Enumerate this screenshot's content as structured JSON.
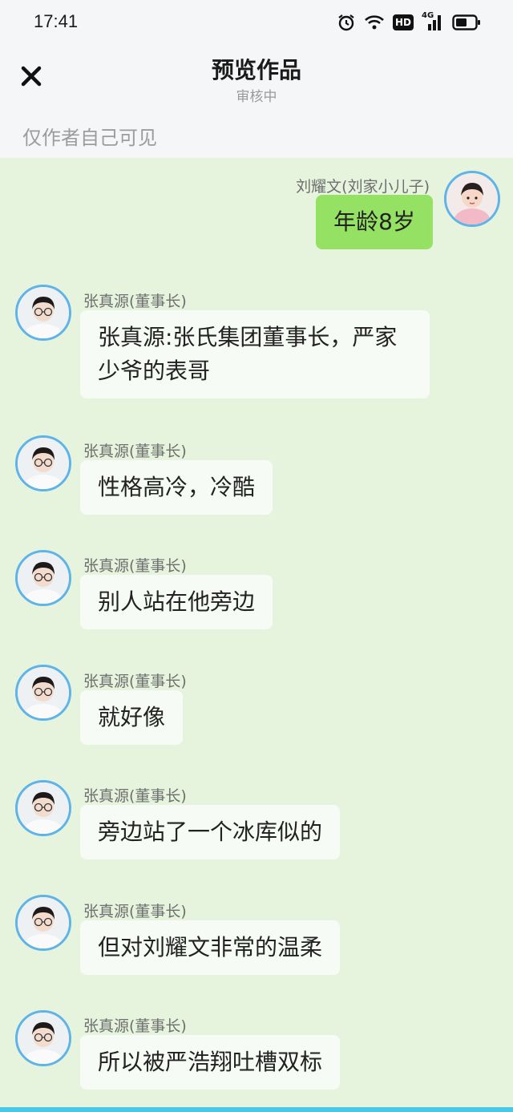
{
  "status_bar": {
    "time": "17:41",
    "icons": [
      "alarm-icon",
      "wifi-icon",
      "hd-icon",
      "signal-4g-icon",
      "battery-icon"
    ],
    "hd_label": "HD",
    "network_label": "4G"
  },
  "header": {
    "title": "预览作品",
    "subtitle": "审核中",
    "close_icon": "close-icon"
  },
  "visibility_note": "仅作者自己可见",
  "messages": [
    {
      "side": "right",
      "sender": "刘耀文(刘家小儿子)",
      "text": "年龄8岁"
    },
    {
      "side": "left",
      "sender": "张真源(董事长)",
      "text": "张真源:张氏集团董事长，严家少爷的表哥"
    },
    {
      "side": "left",
      "sender": "张真源(董事长)",
      "text": "性格高冷，冷酷"
    },
    {
      "side": "left",
      "sender": "张真源(董事长)",
      "text": "别人站在他旁边"
    },
    {
      "side": "left",
      "sender": "张真源(董事长)",
      "text": "就好像"
    },
    {
      "side": "left",
      "sender": "张真源(董事长)",
      "text": "旁边站了一个冰库似的"
    },
    {
      "side": "left",
      "sender": "张真源(董事长)",
      "text": "但对刘耀文非常的温柔"
    },
    {
      "side": "left",
      "sender": "张真源(董事长)",
      "text": "所以被严浩翔吐槽双标"
    }
  ],
  "colors": {
    "chat_background": "#e6f4de",
    "right_bubble": "#95e163",
    "left_bubble": "#f7fbf5",
    "avatar_border": "#5eb3e8"
  }
}
